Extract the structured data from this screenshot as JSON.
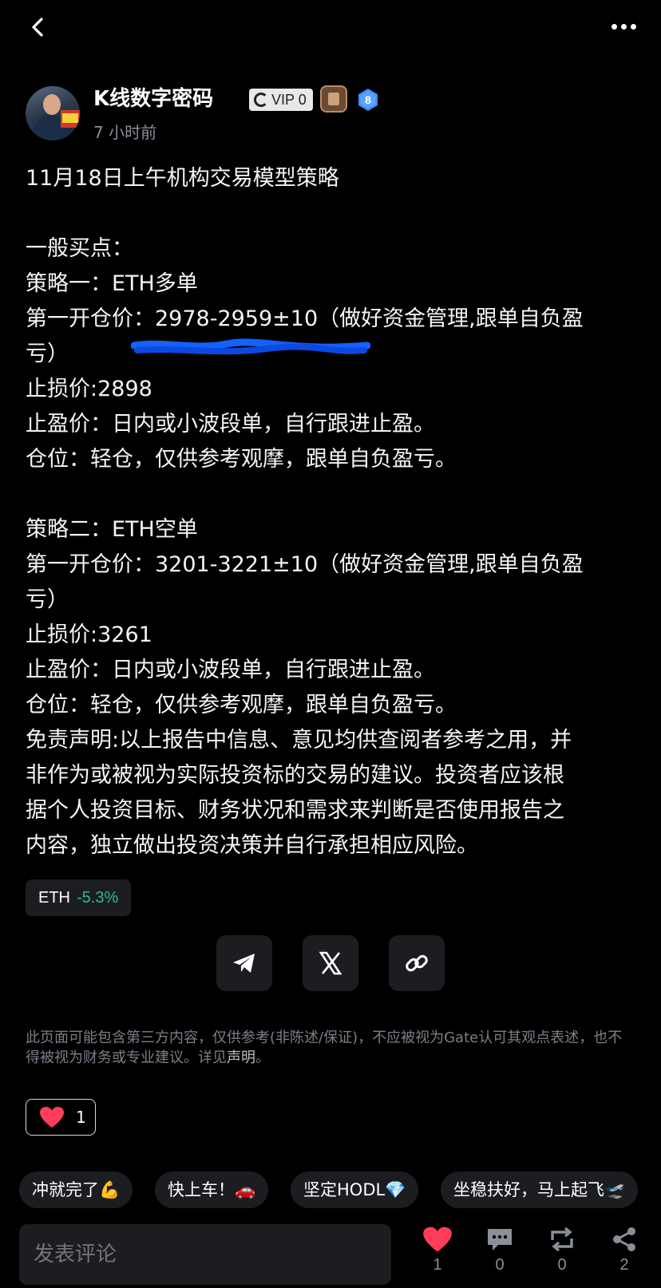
{
  "author": {
    "name": "K线数字密码",
    "vip_label": "VIP 0",
    "level": "8",
    "time": "7 小时前"
  },
  "post": {
    "lines": [
      "11月18日上午机构交易模型策略",
      "",
      "一般买点：",
      "策略一：ETH多单",
      "第一开仓价：2978-2959±10（做好资金管理,跟单自负盈",
      "亏）",
      "止损价:2898",
      "止盈价：日内或小波段单，自行跟进止盈。",
      "仓位：轻仓，仅供参考观摩，跟单自负盈亏。",
      "",
      "策略二：ETH空单",
      "第一开仓价：3201-3221±10（做好资金管理,跟单自负盈",
      "亏）",
      "止损价:3261",
      "止盈价：日内或小波段单，自行跟进止盈。",
      "仓位：轻仓，仅供参考观摩，跟单自负盈亏。",
      "免责声明:以上报告中信息、意见均供查阅者参考之用，并",
      "非作为或被视为实际投资标的交易的建议。投资者应该根",
      "据个人投资目标、财务状况和需求来判断是否使用报告之",
      "内容，独立做出投资决策并自行承担相应风险。"
    ]
  },
  "token": {
    "symbol": "ETH",
    "change": "-5.3%"
  },
  "share_icons": [
    "telegram-icon",
    "x-icon",
    "link-icon"
  ],
  "disclaimer": {
    "text": "此页面可能包含第三方内容，仅供参考(非陈述/保证)，不应被视为Gate认可其观点表述，也不得被视为财务或专业建议。详见",
    "link": "声明",
    "end": "。"
  },
  "likes": "1",
  "quick_replies": [
    "冲就完了💪",
    "快上车！🚗",
    "坚定HODL💎",
    "坐稳扶好，马上起飞🛫"
  ],
  "bottom": {
    "comment_placeholder": "发表评论",
    "like_count": "1",
    "comment_count": "0",
    "repost_count": "0",
    "share_count": "2"
  },
  "colors": {
    "background": "#000000",
    "positive": "#2ebd85",
    "heart": "#ff3d5a",
    "chip": "#1b1d21"
  }
}
